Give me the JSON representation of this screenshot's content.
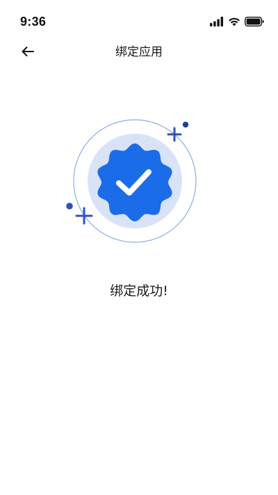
{
  "status_bar": {
    "time": "9:36",
    "icons": [
      "signal-icon",
      "wifi-icon",
      "battery-icon"
    ]
  },
  "nav": {
    "back_icon": "back-arrow-icon",
    "title": "绑定应用"
  },
  "illustration": {
    "icon": "verified-badge-check-icon",
    "colors": {
      "badge": "#1a6ce8",
      "halo": "#d9e3f8",
      "ring": "#8aaedf",
      "accent": "#2f52b8"
    }
  },
  "message": {
    "text": "绑定成功!"
  }
}
